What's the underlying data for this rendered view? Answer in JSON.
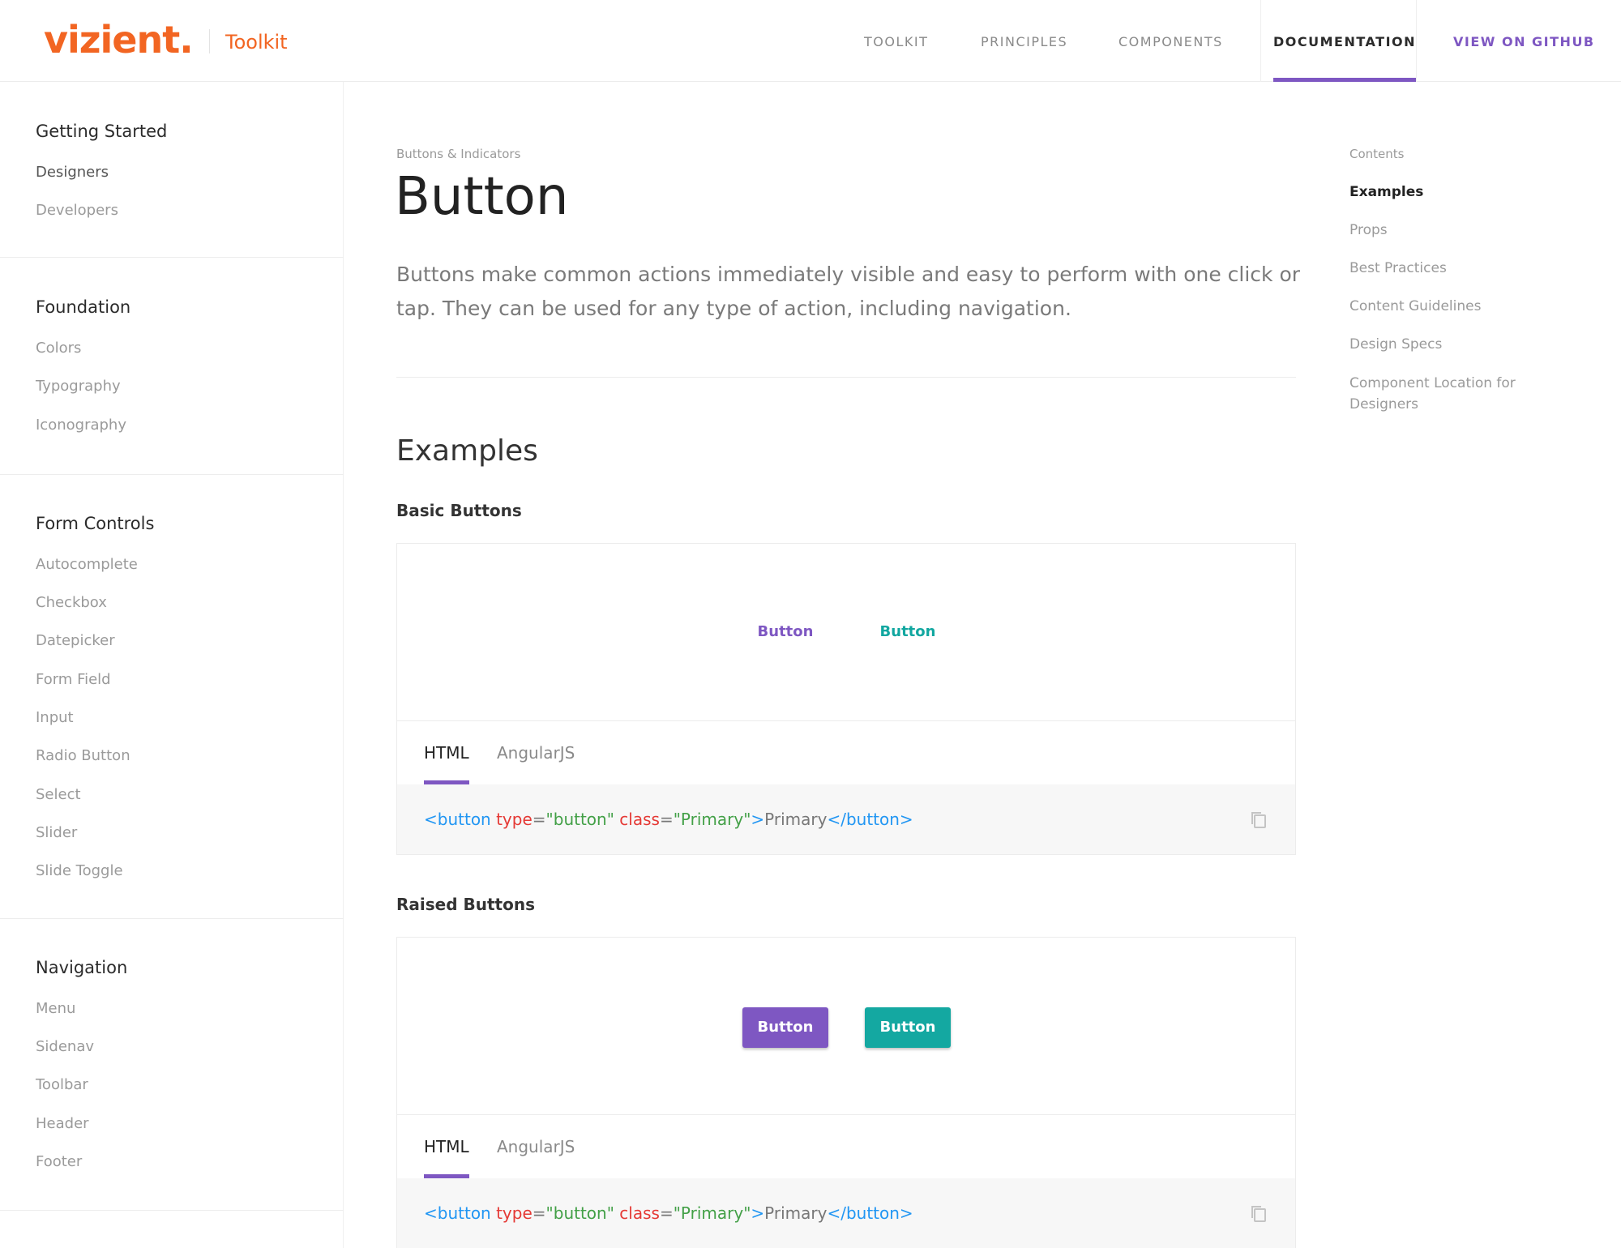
{
  "header": {
    "logo": "vizient",
    "logo_dot": ".",
    "product": "Toolkit",
    "nav": [
      "TOOLKIT",
      "PRINCIPLES",
      "COMPONENTS",
      "DOCUMENTATION",
      "VIEW ON GITHUB"
    ],
    "active_nav": "DOCUMENTATION"
  },
  "sidebar": {
    "groups": [
      {
        "title": "Getting Started",
        "items": [
          "Designers",
          "Developers"
        ]
      },
      {
        "title": "Foundation",
        "items": [
          "Colors",
          "Typography",
          "Iconography"
        ]
      },
      {
        "title": "Form Controls",
        "items": [
          "Autocomplete",
          "Checkbox",
          "Datepicker",
          "Form Field",
          "Input",
          "Radio Button",
          "Select",
          "Slider",
          "Slide Toggle"
        ]
      },
      {
        "title": "Navigation",
        "items": [
          "Menu",
          "Sidenav",
          "Toolbar",
          "Header",
          "Footer"
        ]
      }
    ]
  },
  "main": {
    "breadcrumb": "Buttons & Indicators",
    "title": "Button",
    "intro": "Buttons make common actions immediately visible and easy to perform with one click or tap. They can be used for any type of action, including navigation.",
    "section": "Examples",
    "examples": [
      {
        "title": "Basic Buttons",
        "buttons": [
          "Button",
          "Button"
        ],
        "tabs": [
          "HTML",
          "AngularJS"
        ],
        "code": {
          "open": "<button",
          "attr1": "type",
          "eq1": "=",
          "val1": "\"button\"",
          "attr2": "class",
          "eq2": "=",
          "val2": "\"Primary\"",
          "gt": ">",
          "text": "Primary",
          "close": "</button>"
        }
      },
      {
        "title": "Raised Buttons",
        "buttons": [
          "Button",
          "Button"
        ],
        "tabs": [
          "HTML",
          "AngularJS"
        ],
        "code": {
          "open": "<button",
          "attr1": "type",
          "eq1": "=",
          "val1": "\"button\"",
          "attr2": "class",
          "eq2": "=",
          "val2": "\"Primary\"",
          "gt": ">",
          "text": "Primary",
          "close": "</button>"
        }
      }
    ]
  },
  "toc": {
    "heading": "Contents",
    "items": [
      "Examples",
      "Props",
      "Best Practices",
      "Content Guidelines",
      "Design Specs",
      "Component Location for Designers"
    ],
    "active": "Examples"
  },
  "colors": {
    "brand": "#f26522",
    "primary": "#7e57c2",
    "accent": "#14a8a1",
    "code_tag": "#2196f3",
    "code_attr": "#e53935",
    "code_string": "#43a047"
  },
  "icons": {
    "copy": "copy-icon"
  }
}
